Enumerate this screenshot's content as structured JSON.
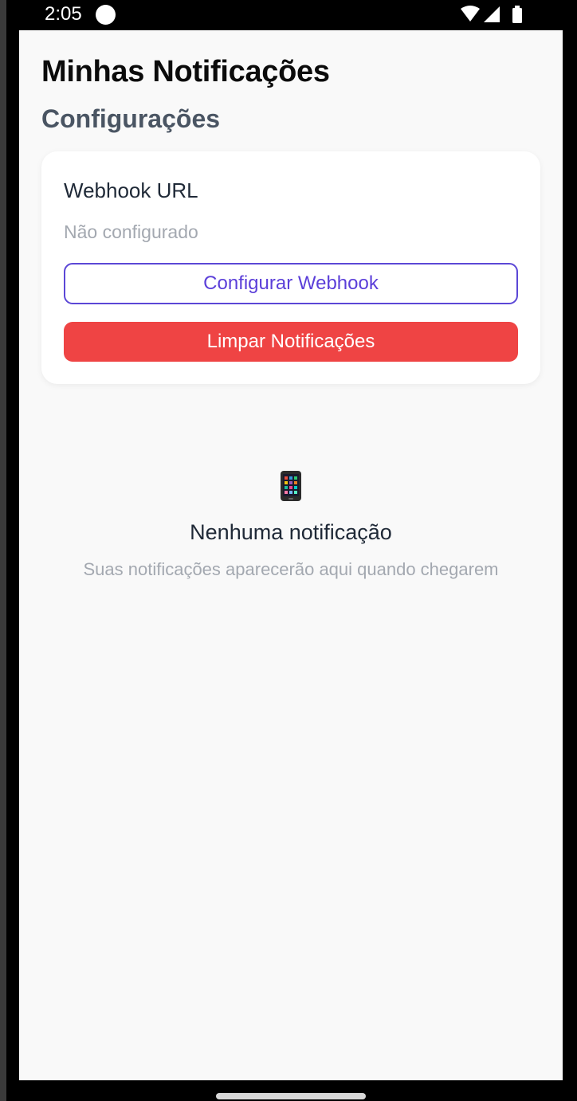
{
  "status_bar": {
    "time": "2:05",
    "icons": [
      "wifi-icon",
      "signal-icon",
      "battery-icon"
    ]
  },
  "header": {
    "title": "Minhas Notificações",
    "section_title": "Configurações"
  },
  "webhook_card": {
    "label": "Webhook URL",
    "value": "Não configurado",
    "configure_button": "Configurar Webhook",
    "clear_button": "Limpar Notificações"
  },
  "empty_state": {
    "icon": "mobile-phone-icon",
    "title": "Nenhuma notificação",
    "subtitle": "Suas notificações aparecerão aqui quando chegarem"
  },
  "colors": {
    "accent": "#5b47d6",
    "danger": "#ef4444",
    "background": "#f9f9f9"
  }
}
